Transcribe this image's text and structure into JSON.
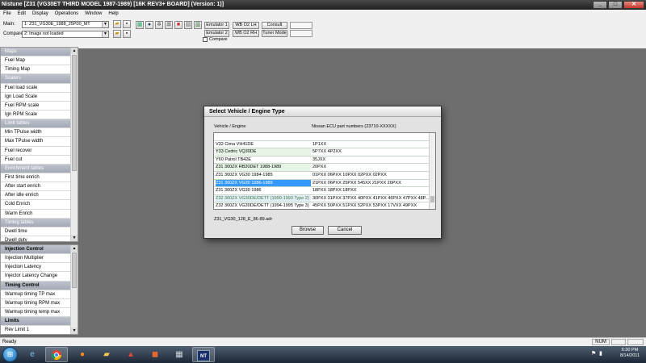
{
  "window": {
    "title": "Nistune [Z31 (VG30ET THIRD MODEL 1987-1989) [16K REV3+ BOARD] (Version: 1)]",
    "controls": [
      "_",
      "□",
      "✕"
    ]
  },
  "menu": [
    "File",
    "Edit",
    "Display",
    "Operations",
    "Window",
    "Help"
  ],
  "toolbar": {
    "main_label": "Main:",
    "main_value": "1: Z31_VG30E_1988_25P00_MT",
    "compare_label": "Compare:",
    "compare_value": "2: Image not loaded",
    "emulator1": "Emulator 1",
    "emulator2": "Emulator 2",
    "wb_o2_lh": "WB O2 LH",
    "wb_o2_rh": "WB O2 RH",
    "consult": "Consult",
    "tuner_mode": "Tuner Mode",
    "compare_check": "Compare"
  },
  "sidebar_top": [
    {
      "label": "Maps",
      "header": true
    },
    {
      "label": "Fuel Map"
    },
    {
      "label": "Timing Map"
    },
    {
      "label": "Scalers",
      "header": true
    },
    {
      "label": "Fuel load scale"
    },
    {
      "label": "Ign Load Scale"
    },
    {
      "label": "Fuel RPM scale"
    },
    {
      "label": "Ign RPM Scale"
    },
    {
      "label": "Limit tables",
      "header": true
    },
    {
      "label": "Min TPulse width"
    },
    {
      "label": "Max TPulse width"
    },
    {
      "label": "Fuel recover"
    },
    {
      "label": "Fuel cut"
    },
    {
      "label": "Enrichment tables",
      "header": true
    },
    {
      "label": "First time enrich"
    },
    {
      "label": "After start enrich"
    },
    {
      "label": "After idle enrich"
    },
    {
      "label": "Cold Enrich"
    },
    {
      "label": "Warm Enrich"
    },
    {
      "label": "Timing tables",
      "header": true
    },
    {
      "label": "Dwell time"
    },
    {
      "label": "Dwell duty"
    }
  ],
  "sidebar_bottom": [
    {
      "label": "Injection Control",
      "header": true
    },
    {
      "label": "Injection Multiplier"
    },
    {
      "label": "Injection Latency"
    },
    {
      "label": "Injector Latency Change"
    },
    {
      "label": "Timing Control",
      "header": true
    },
    {
      "label": "Warmup timing TP max"
    },
    {
      "label": "Warmup timing RPM max"
    },
    {
      "label": "Warmup timing temp max"
    },
    {
      "label": "Limits",
      "header": true
    },
    {
      "label": "Rev Limit 1"
    }
  ],
  "dialog": {
    "title": "Select Vehicle / Engine Type",
    "col_vehicle": "Vehicle / Engine",
    "col_part": "Nissan ECU part numbers (23710-XXXXX)",
    "rows": [
      {
        "vehicle": "",
        "part": ""
      },
      {
        "vehicle": "V32 Cima VH41DE",
        "part": "1P1XX",
        "style": "plain"
      },
      {
        "vehicle": "Y33 Cedric VQ30DE",
        "part": "5P7XX 4P2XX",
        "style": "green"
      },
      {
        "vehicle": "Y60 Patrol TB42E",
        "part": "35JXX",
        "style": "plain"
      },
      {
        "vehicle": "Z31 300ZX RB20DET 1988-1989",
        "part": "20PXX",
        "style": "green"
      },
      {
        "vehicle": "Z31 300ZX VG30 1984-1985",
        "part": "01PXX 06PXX 10PXX 02PXX 02PXX",
        "style": "plain"
      },
      {
        "vehicle": "Z31 300ZX VG30 1986-1989",
        "part": "21PXX 06PXX 25PXX 545XX 21PXX 26PXX",
        "style": "sel"
      },
      {
        "vehicle": "Z31 300ZX VG30 1986",
        "part": "18PXX 18PXX 18PXX",
        "style": "plain"
      },
      {
        "vehicle": "Z32 300ZX VG30DE/DETT (1990-1993 Type 2)",
        "part": "30PXX 31PXX 37PXX 40PXX 41PXX 46PXX 47PXX 48P...",
        "style": "blueish"
      },
      {
        "vehicle": "Z32 300ZX VG30DE/DETT (1994-1995 Type 3)",
        "part": "45PXX 50PXX 51PXX 52PXX 53PXX 17VXX 49PXX",
        "style": "plain"
      }
    ],
    "filename": "Z31_VG30_128_E_86-89.adr",
    "browse": "Browse",
    "cancel": "Cancel"
  },
  "status": {
    "ready": "Ready",
    "num": "NUM"
  },
  "taskbar": {
    "time": "6:30 PM",
    "date": "8/14/2011",
    "apps": [
      "ie-icon",
      "chrome-icon",
      "firefox-icon",
      "folder-icon",
      "acrobat-icon",
      "office-icon",
      "spreadsheet-icon",
      "nistune-icon"
    ]
  }
}
